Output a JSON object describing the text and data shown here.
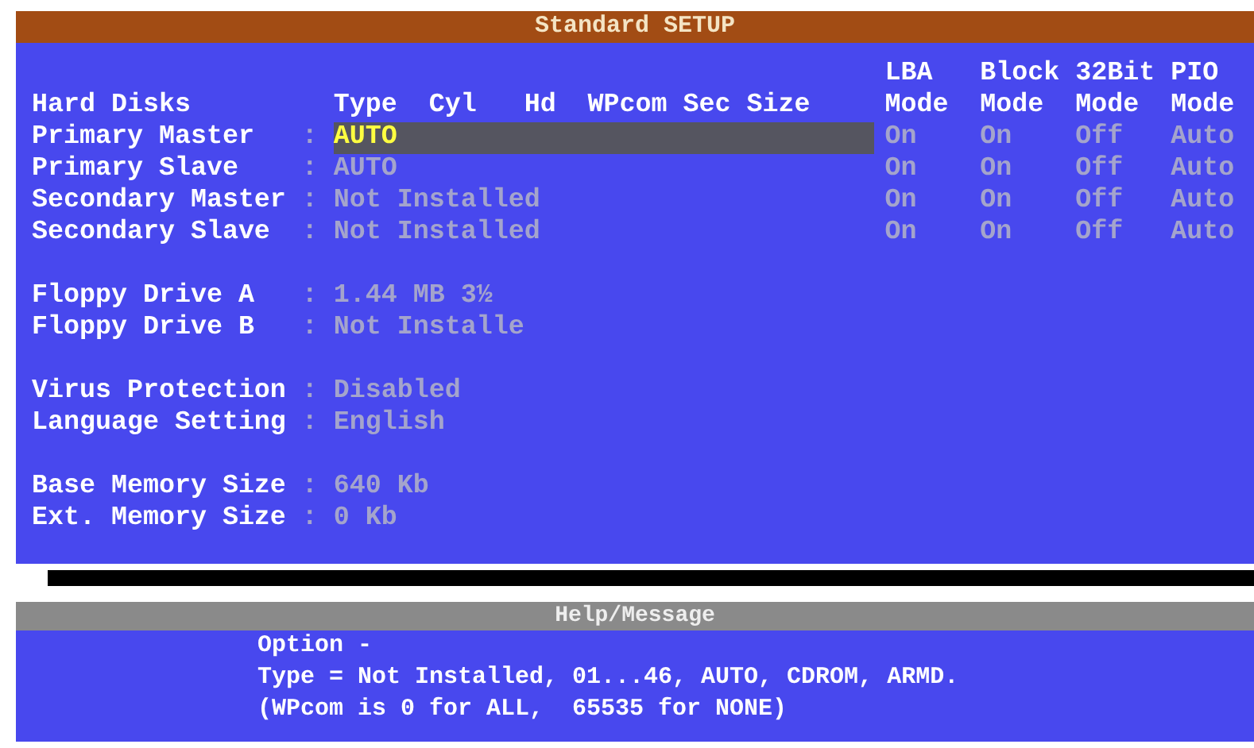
{
  "title": "Standard SETUP",
  "mode_headers": [
    {
      "top": "LBA",
      "bottom": "Mode"
    },
    {
      "top": "Block",
      "bottom": "Mode"
    },
    {
      "top": "32Bit",
      "bottom": "Mode"
    },
    {
      "top": "PIO",
      "bottom": "Mode"
    }
  ],
  "hard_disks": {
    "label": "Hard Disks",
    "columns": [
      "Type",
      "Cyl",
      "Hd",
      "WPcom",
      "Sec",
      "Size"
    ],
    "rows": [
      {
        "name": "Primary Master",
        "colon": ":",
        "type": "AUTO",
        "lba": "On",
        "block": "On",
        "bit32": "Off",
        "pio": "Auto",
        "selected": true
      },
      {
        "name": "Primary Slave",
        "colon": ":",
        "type": "AUTO",
        "lba": "On",
        "block": "On",
        "bit32": "Off",
        "pio": "Auto",
        "selected": false
      },
      {
        "name": "Secondary Master",
        "colon": ":",
        "type": "Not Installed",
        "lba": "On",
        "block": "On",
        "bit32": "Off",
        "pio": "Auto",
        "selected": false
      },
      {
        "name": "Secondary Slave",
        "colon": ":",
        "type": "Not Installed",
        "lba": "On",
        "block": "On",
        "bit32": "Off",
        "pio": "Auto",
        "selected": false
      }
    ]
  },
  "setting_groups": [
    [
      {
        "label": "Floppy Drive A",
        "colon": ":",
        "value": "1.44 MB 3½"
      },
      {
        "label": "Floppy Drive B",
        "colon": ":",
        "value": "Not Installe"
      }
    ],
    [
      {
        "label": "Virus Protection",
        "colon": ":",
        "value": "Disabled"
      },
      {
        "label": "Language Setting",
        "colon": ":",
        "value": "English"
      }
    ],
    [
      {
        "label": "Base Memory Size",
        "colon": ":",
        "value": "640 Kb"
      },
      {
        "label": "Ext. Memory Size",
        "colon": ":",
        "value": "0 Kb"
      }
    ]
  ],
  "help": {
    "title": "Help/Message",
    "lines": [
      "Option -",
      "Type = Not Installed, 01...46, AUTO, CDROM, ARMD.",
      "(WPcom is 0 for ALL,  65535 for NONE)"
    ]
  }
}
